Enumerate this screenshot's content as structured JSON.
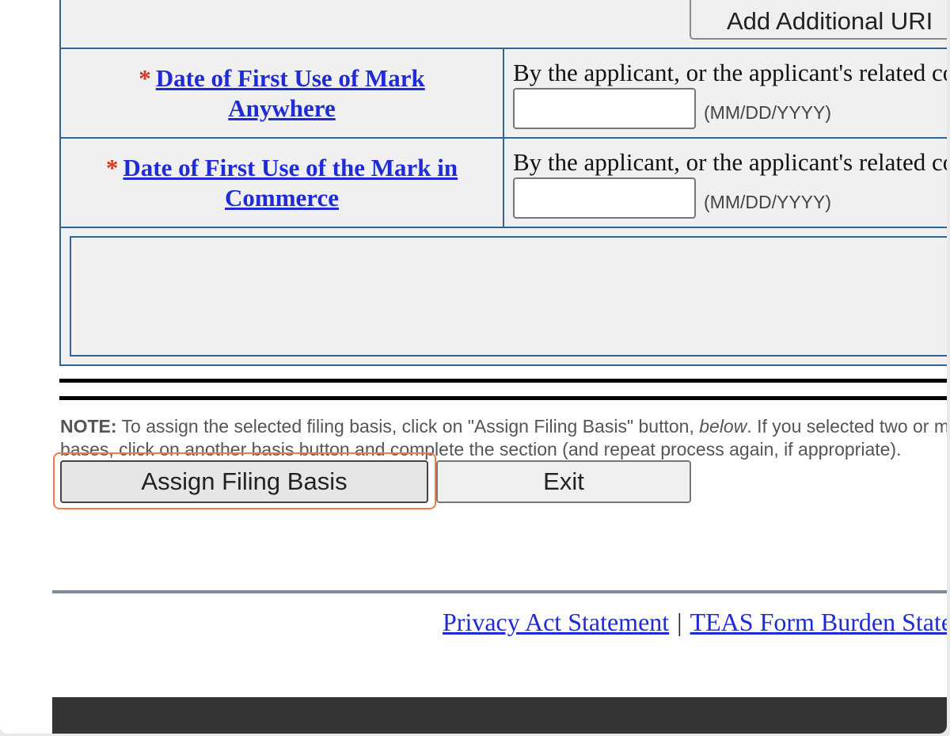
{
  "form": {
    "add_url_button": "Add Additional URI",
    "required_marker": "*",
    "rows": [
      {
        "label_line1": "Date of First Use of Mark",
        "label_line2": "Anywhere",
        "description": "By the applicant, or the applicant's related company",
        "date_value": "",
        "date_hint": "(MM/DD/YYYY)"
      },
      {
        "label_line1": "Date of First Use of the Mark in",
        "label_line2": "Commerce",
        "description": "By the applicant, or the applicant's related company",
        "date_value": "",
        "date_hint": "(MM/DD/YYYY)"
      }
    ]
  },
  "note": {
    "label": "NOTE:",
    "text1": " To assign the selected filing basis, click on \"Assign Filing Basis\" button, ",
    "emphasis": "below",
    "text2": ". If you selected two or more",
    "line2": "bases, click on another basis button and complete the section (and repeat process again, if appropriate)."
  },
  "buttons": {
    "assign": "Assign Filing Basis",
    "exit": "Exit"
  },
  "footer": {
    "privacy": "Privacy Act Statement",
    "separator": "|",
    "burden": "TEAS Form Burden Statement"
  }
}
